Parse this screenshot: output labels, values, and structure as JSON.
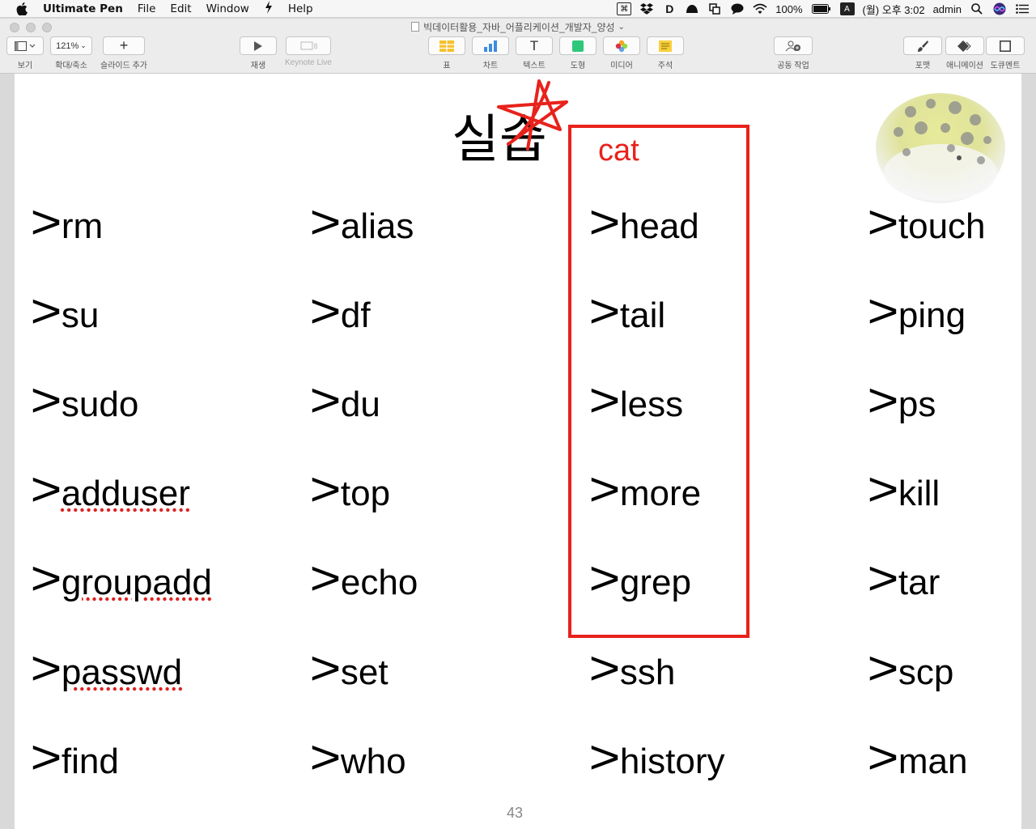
{
  "menubar": {
    "app_name": "Ultimate Pen",
    "items": [
      "File",
      "Edit",
      "Window",
      "Help"
    ],
    "battery": "100%",
    "input_method": "A",
    "clock": "(월) 오후 3:02",
    "user": "admin"
  },
  "window": {
    "title": "빅데이터활용_자바_어플리케이션_개발자_양성"
  },
  "toolbar": {
    "view_label": "보기",
    "zoom_value": "121%",
    "zoom_label": "확대/축소",
    "add_slide_label": "슬라이드 추가",
    "play_label": "재생",
    "keynote_live_label": "Keynote Live",
    "table_label": "표",
    "chart_label": "차트",
    "text_label": "텍스트",
    "shape_label": "도형",
    "media_label": "미디어",
    "comment_label": "주석",
    "collaborate_label": "공동 작업",
    "format_label": "포맷",
    "animate_label": "애니메이션",
    "document_label": "도큐멘트"
  },
  "slide": {
    "title": "실습",
    "cat_label": "cat",
    "page_number": "43",
    "columns": [
      [
        "rm",
        "su",
        "sudo",
        "adduser",
        "groupadd",
        "passwd",
        "find"
      ],
      [
        "alias",
        "df",
        "du",
        "top",
        "echo",
        "set",
        "who"
      ],
      [
        "head",
        "tail",
        "less",
        "more",
        "grep",
        "ssh",
        "history"
      ],
      [
        "touch",
        "ping",
        "ps",
        "kill",
        "tar",
        "scp",
        "man"
      ]
    ],
    "prompt_glyph": ">",
    "colors": {
      "annotation": "#e8221b"
    }
  }
}
